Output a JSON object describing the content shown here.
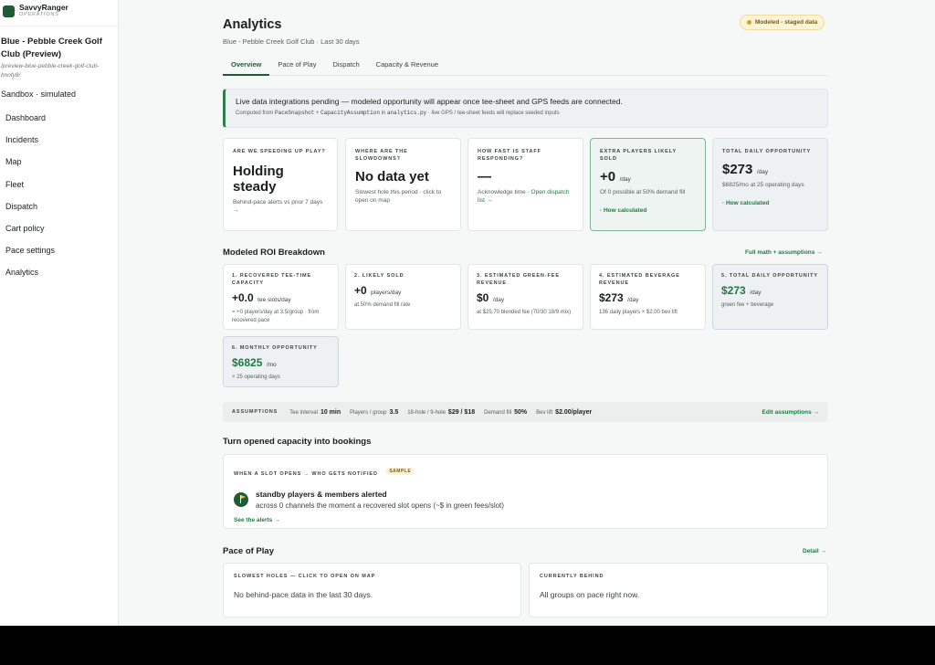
{
  "brand": {
    "name": "SavvyRanger",
    "sub": "OPERATIONS"
  },
  "club": {
    "name": "Blue - Pebble Creek Golf Club (Preview)",
    "path": "/preview-blue-pebble-creek-golf-club-hnofy8/",
    "mode": "Sandbox · simulated"
  },
  "nav": [
    "Dashboard",
    "Incidents",
    "Map",
    "Fleet",
    "Dispatch",
    "Cart policy",
    "Pace settings",
    "Analytics"
  ],
  "header": {
    "title": "Analytics",
    "subtitle": "Blue - Pebble Creek Golf Club · Last 30 days",
    "badge": "Modeled - staged data"
  },
  "tabs": [
    "Overview",
    "Pace of Play",
    "Dispatch",
    "Capacity & Revenue"
  ],
  "banner": {
    "title": "Live data integrations pending — modeled opportunity will appear once tee-sheet and GPS feeds are connected.",
    "prefix": "Computed from",
    "code1": "PaceSnapshot",
    "plus": "+",
    "code2": "CapacityAssumption",
    "in": "in",
    "code3": "analytics.py",
    "suffix": "· live GPS / tee-sheet feeds will replace seeded inputs"
  },
  "kpis": {
    "speed": {
      "kicker": "Are we speeding up play?",
      "value_line1": "Holding",
      "value_line2": "steady",
      "note": "Behind-pace alerts vs prior 7 days →"
    },
    "slowdowns": {
      "kicker": "Where are the slowdowns?",
      "value": "No data yet",
      "note": "Slowest hole this period · click to open on map"
    },
    "staff": {
      "kicker": "How fast is staff responding?",
      "value": "—",
      "note": "Acknowledge time ·",
      "link": "Open dispatch list →"
    },
    "extra": {
      "kicker": "Extra players likely sold",
      "value": "+0",
      "unit": "/day",
      "note": "Of 0 possible at 50% demand fill",
      "link": "· How calculated"
    },
    "daily": {
      "kicker": "Total daily opportunity",
      "value": "$273",
      "unit": "/day",
      "note": "$6825/mo at 25 operating days",
      "link": "· How calculated"
    }
  },
  "roi": {
    "title": "Modeled ROI Breakdown",
    "link": "Full math + assumptions →",
    "cards": [
      {
        "kicker": "1. Recovered tee-time capacity",
        "value": "+0.0",
        "unit": "tee slots/day",
        "note": "= +0 players/day at 3.5/group · from recovered pace"
      },
      {
        "kicker": "2. Likely sold",
        "value": "+0",
        "unit": "players/day",
        "note": "at 50% demand fill rate"
      },
      {
        "kicker": "3. Estimated green-fee revenue",
        "value": "$0",
        "unit": "/day",
        "note": "at $25.70 blended fee (70/30 18/9 mix)"
      },
      {
        "kicker": "4. Estimated beverage revenue",
        "value": "$273",
        "unit": "/day",
        "note": "136 daily players × $2.00 bev lift"
      },
      {
        "kicker": "5. Total daily opportunity",
        "value": "$273",
        "unit": "/day",
        "note": "green fee + beverage"
      },
      {
        "kicker": "6. Monthly opportunity",
        "value": "$6825",
        "unit": "/mo",
        "note": "× 25 operating days"
      }
    ]
  },
  "assumptions": {
    "kicker": "ASSUMPTIONS",
    "items": [
      {
        "label": "Tee interval",
        "value": "10 min"
      },
      {
        "label": "Players / group",
        "value": "3.5"
      },
      {
        "label": "18-hole / 9-hole",
        "value": "$29 / $18"
      },
      {
        "label": "Demand fill",
        "value": "50%"
      },
      {
        "label": "Bev lift",
        "value": "$2.00/player"
      }
    ],
    "edit": "Edit assumptions →"
  },
  "bookings": {
    "title": "Turn opened capacity into bookings",
    "kicker": "WHEN A SLOT OPENS → WHO GETS NOTIFIED",
    "badge": "SAMPLE",
    "heading": "standby players & members alerted",
    "body": "across 0 channels the moment a recovered slot opens (~$ in green fees/slot)",
    "link": "See the alerts →"
  },
  "pace": {
    "title": "Pace of Play",
    "link": "Detail →",
    "slowest_kicker": "SLOWEST HOLES — CLICK TO OPEN ON MAP",
    "slowest_text": "No behind-pace data in the last 30 days.",
    "behind_kicker": "CURRENTLY BEHIND",
    "behind_text": "All groups on pace right now."
  },
  "colors": {
    "accent": "#1f7a42",
    "brand": "#1f5c36",
    "badge_bg": "#fdf3d6"
  }
}
